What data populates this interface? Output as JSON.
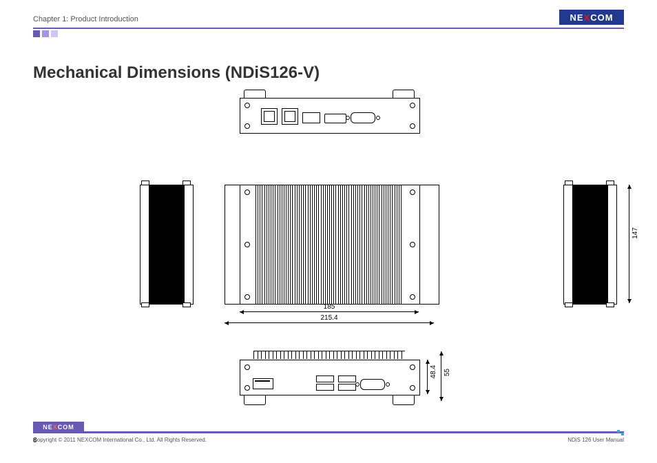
{
  "header": {
    "chapter": "Chapter 1: Product Introduction",
    "brand_left": "NE",
    "brand_x": "X",
    "brand_right": "COM"
  },
  "title": "Mechanical Dimensions (NDiS126-V)",
  "dimensions": {
    "width_inner": "185",
    "width_outer": "215.4",
    "depth": "147",
    "height_body": "48.4",
    "height_total": "55"
  },
  "footer": {
    "copyright": "Copyright © 2011 NEXCOM International Co., Ltd. All Rights Reserved.",
    "page": "8",
    "manual": "NDiS 126 User Manual",
    "brand_left": "NE",
    "brand_x": "X",
    "brand_right": "COM"
  }
}
